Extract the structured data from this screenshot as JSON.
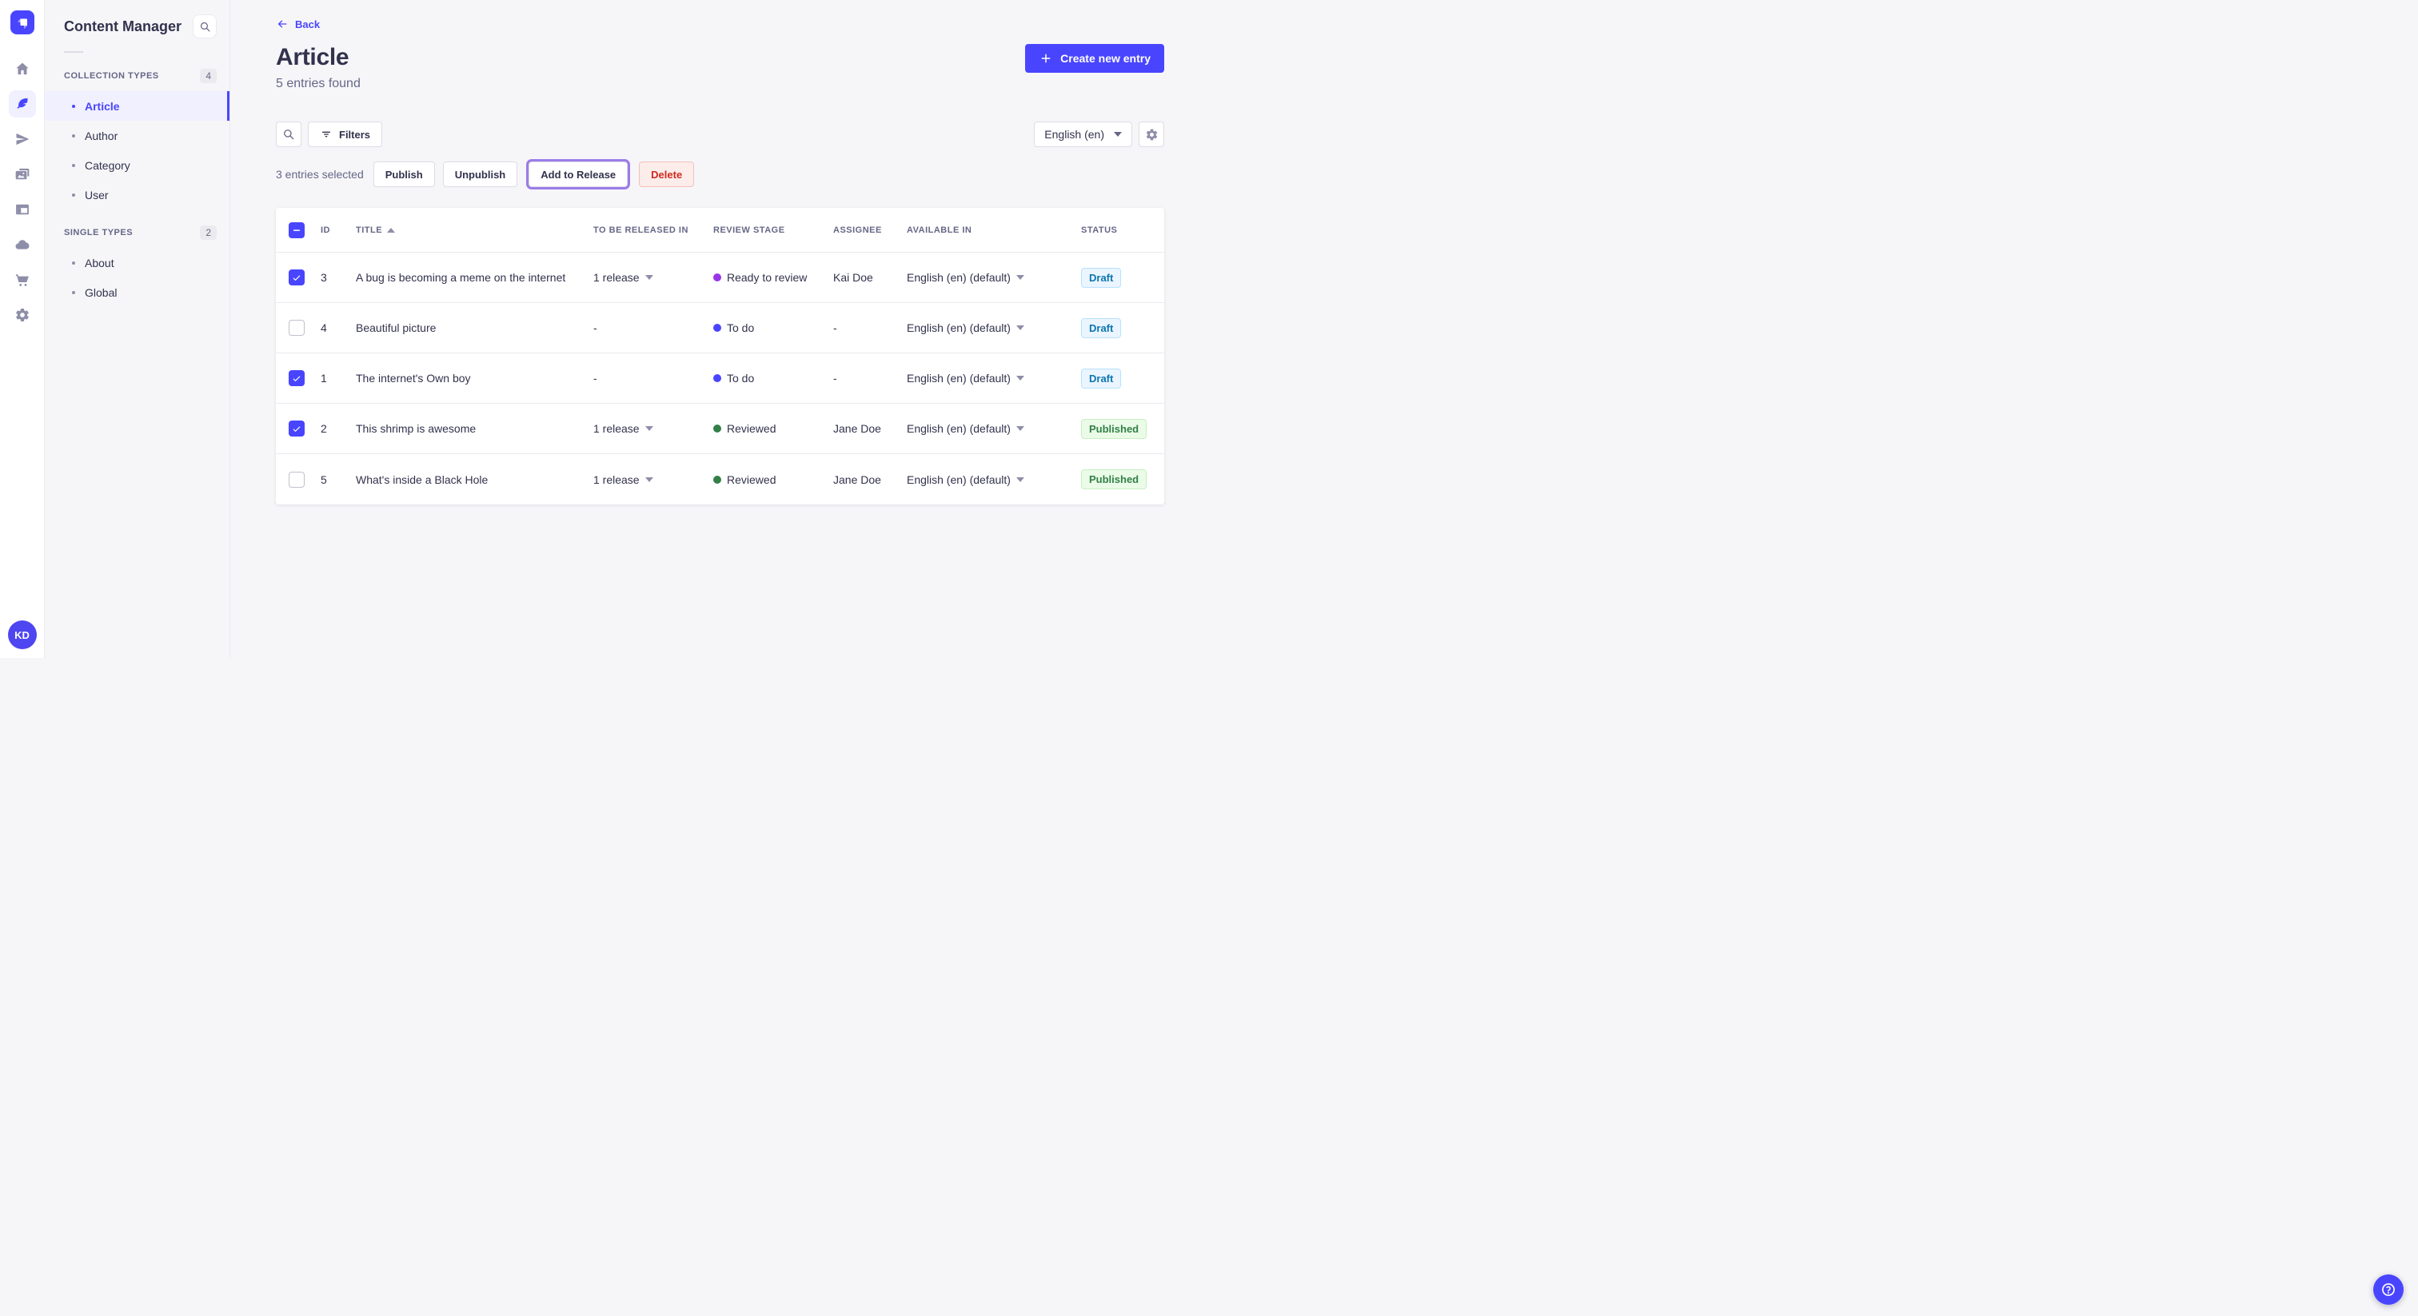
{
  "rail": {
    "logo_icon": "strapi-logo-icon",
    "items": [
      {
        "icon": "home-icon",
        "active": false
      },
      {
        "icon": "feather-content-icon",
        "active": true
      },
      {
        "icon": "paper-plane-icon",
        "active": false
      },
      {
        "icon": "media-images-icon",
        "active": false
      },
      {
        "icon": "layout-builder-icon",
        "active": false
      },
      {
        "icon": "cloud-icon",
        "active": false
      },
      {
        "icon": "cart-marketplace-icon",
        "active": false
      },
      {
        "icon": "gear-settings-icon",
        "active": false
      }
    ],
    "avatar_initials": "KD"
  },
  "sidebar": {
    "title": "Content Manager",
    "search_icon": "search-icon",
    "sections": [
      {
        "label": "COLLECTION TYPES",
        "count": "4",
        "items": [
          {
            "label": "Article",
            "active": true
          },
          {
            "label": "Author",
            "active": false
          },
          {
            "label": "Category",
            "active": false
          },
          {
            "label": "User",
            "active": false
          }
        ]
      },
      {
        "label": "SINGLE TYPES",
        "count": "2",
        "items": [
          {
            "label": "About",
            "active": false
          },
          {
            "label": "Global",
            "active": false
          }
        ]
      }
    ]
  },
  "header": {
    "back_label": "Back",
    "title": "Article",
    "subtitle": "5 entries found",
    "create_label": "Create new entry"
  },
  "toolbar": {
    "filters_label": "Filters",
    "locale_value": "English (en)"
  },
  "bulk": {
    "selected_text": "3 entries selected",
    "publish_label": "Publish",
    "unpublish_label": "Unpublish",
    "add_to_release_label": "Add to Release",
    "delete_label": "Delete"
  },
  "table": {
    "headers": {
      "id": "ID",
      "title": "TITLE",
      "to_be_released_in": "TO BE RELEASED IN",
      "review_stage": "REVIEW STAGE",
      "assignee": "ASSIGNEE",
      "available_in": "AVAILABLE IN",
      "status": "STATUS"
    },
    "rows": [
      {
        "checked": true,
        "id": "3",
        "title": "A bug is becoming a meme on the internet",
        "release": "1 release",
        "release_dropdown": true,
        "stage": "Ready to review",
        "stage_color": "#9736E8",
        "assignee": "Kai Doe",
        "locale": "English (en) (default)",
        "status": "Draft"
      },
      {
        "checked": false,
        "id": "4",
        "title": "Beautiful picture",
        "release": "-",
        "release_dropdown": false,
        "stage": "To do",
        "stage_color": "#4945FF",
        "assignee": "-",
        "locale": "English (en) (default)",
        "status": "Draft"
      },
      {
        "checked": true,
        "id": "1",
        "title": "The internet's Own boy",
        "release": "-",
        "release_dropdown": false,
        "stage": "To do",
        "stage_color": "#4945FF",
        "assignee": "-",
        "locale": "English (en) (default)",
        "status": "Draft"
      },
      {
        "checked": true,
        "id": "2",
        "title": "This shrimp is awesome",
        "release": "1 release",
        "release_dropdown": true,
        "stage": "Reviewed",
        "stage_color": "#328048",
        "assignee": "Jane Doe",
        "locale": "English (en) (default)",
        "status": "Published"
      },
      {
        "checked": false,
        "id": "5",
        "title": "What's inside a Black Hole",
        "release": "1 release",
        "release_dropdown": true,
        "stage": "Reviewed",
        "stage_color": "#328048",
        "assignee": "Jane Doe",
        "locale": "English (en) (default)",
        "status": "Published"
      }
    ]
  },
  "colors": {
    "primary": "#4945FF",
    "add_to_release_ring": "#9B7CE8",
    "status_styles": {
      "Draft": {
        "bg": "#EAF5FF",
        "border": "#B8E1FF",
        "text": "#0C75AF"
      },
      "Published": {
        "bg": "#EAFBE7",
        "border": "#C6F0C2",
        "text": "#328048"
      }
    },
    "danger": {
      "bg": "#FCECEA",
      "border": "#F5C0B8",
      "text": "#D02B20"
    }
  }
}
